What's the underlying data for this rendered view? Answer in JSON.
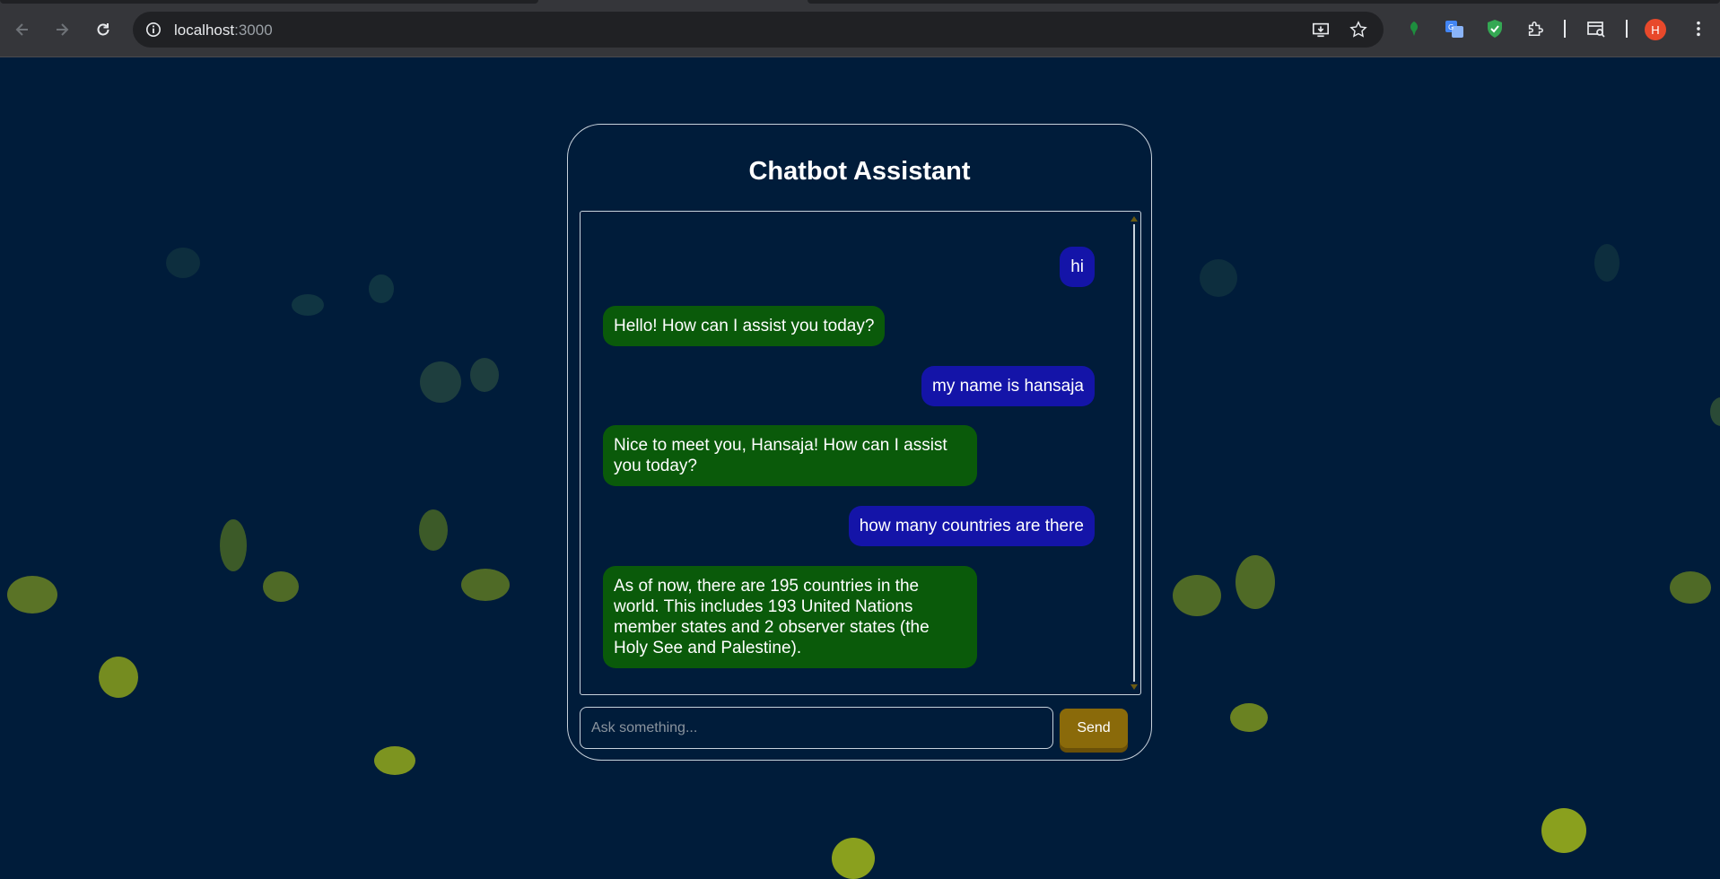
{
  "browser": {
    "url_host": "localhost",
    "url_port": ":3000",
    "profile_initial": "H",
    "icons": {
      "back": "back-arrow-icon",
      "forward": "forward-arrow-icon",
      "reload": "reload-icon",
      "site_info": "info-icon",
      "install": "install-app-icon",
      "bookmark": "star-icon",
      "ext1": "green-leaf-extension-icon",
      "ext2": "translate-extension-icon",
      "ext3": "shield-extension-icon",
      "extensions": "puzzle-icon",
      "tab_search": "tab-search-icon",
      "menu": "kebab-menu-icon"
    }
  },
  "chat": {
    "title": "Chatbot Assistant",
    "messages": [
      {
        "role": "user",
        "text": "hi"
      },
      {
        "role": "bot",
        "text": "Hello! How can I assist you today?"
      },
      {
        "role": "user",
        "text": "my name is hansaja"
      },
      {
        "role": "bot",
        "text": "Nice to meet you, Hansaja! How can I assist you today?"
      },
      {
        "role": "user",
        "text": "how many countries are there"
      },
      {
        "role": "bot",
        "text": "As of now, there are 195 countries in the world. This includes 193 United Nations member states and 2 observer states (the Holy See and Palestine)."
      }
    ],
    "input": {
      "value": "",
      "placeholder": "Ask something..."
    },
    "send_label": "Send"
  },
  "colors": {
    "background": "#001c3a",
    "user_bubble": "#1414a8",
    "bot_bubble": "#0a5a0a",
    "send_button": "#8a6a0a",
    "decor_bubble": "#7a8f1e"
  }
}
